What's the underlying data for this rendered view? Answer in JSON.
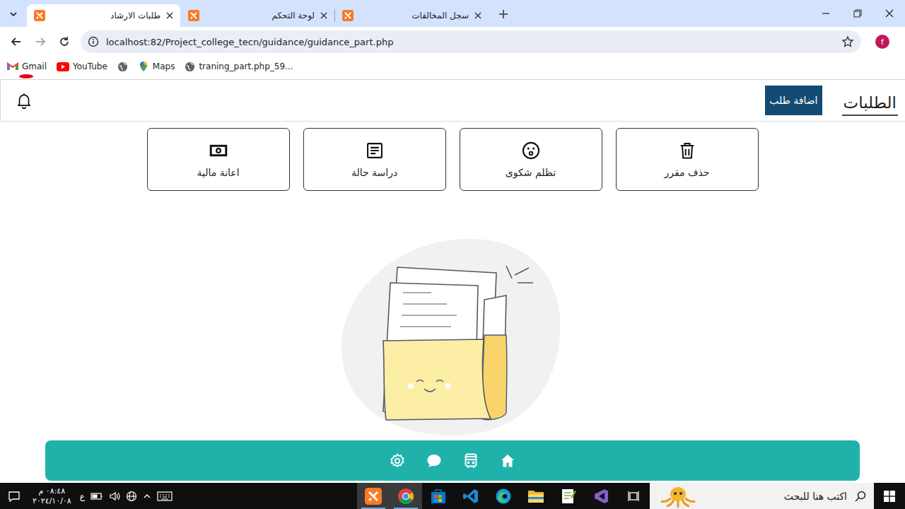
{
  "browser": {
    "tabs": [
      {
        "label": "طلبات الارشاد",
        "selected": true
      },
      {
        "label": "لوحة التحكم",
        "selected": false
      },
      {
        "label": "سجل المخالفات",
        "selected": false
      }
    ],
    "address": "localhost:82/Project_college_tecn/guidance/guidance_part.php",
    "bookmarks": [
      {
        "kind": "gmail",
        "label": "Gmail"
      },
      {
        "kind": "youtube",
        "label": "YouTube"
      },
      {
        "kind": "globe"
      },
      {
        "kind": "maps",
        "label": "Maps"
      },
      {
        "kind": "globe",
        "label": "traning_part.php_59..."
      }
    ],
    "profile_initial": "f"
  },
  "page": {
    "title": "الطلبات",
    "add_button": "اضافة طلب",
    "has_notification": true,
    "categories": [
      "حذف مقرر",
      "تظلم شكوى",
      "دراسة حالة",
      "اعانة مالية"
    ]
  },
  "taskbar": {
    "search_placeholder": "اكتب هنا للبحث",
    "apps": [
      {
        "kind": "visualstudio",
        "open": false
      },
      {
        "kind": "notepad",
        "open": false
      },
      {
        "kind": "explorer",
        "open": false
      },
      {
        "kind": "edge",
        "open": false
      },
      {
        "kind": "vscode",
        "open": false
      },
      {
        "kind": "store",
        "open": false
      },
      {
        "kind": "chrome",
        "open": true
      },
      {
        "kind": "xampp",
        "open": true
      }
    ],
    "language": "ع",
    "time": "٠٨:٤٨ م",
    "date": "٢٠٢٤/١٠/٠٨"
  }
}
